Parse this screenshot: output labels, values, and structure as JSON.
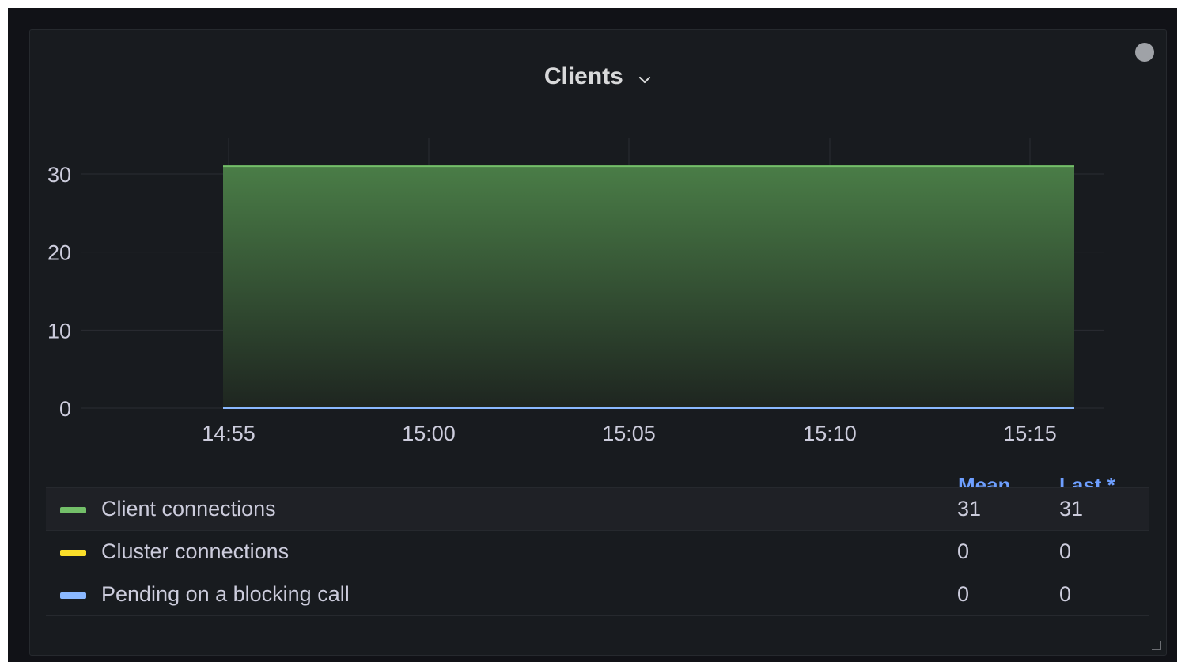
{
  "panel": {
    "title": "Clients",
    "menu_icon": "chevron-down-icon",
    "status_icon": "status-dot-icon"
  },
  "legend": {
    "headers": {
      "mean": "Mean",
      "last": "Last *"
    },
    "rows": [
      {
        "name": "Client connections",
        "color": "#73bf69",
        "mean": "31",
        "last": "31"
      },
      {
        "name": "Cluster connections",
        "color": "#fade2a",
        "mean": "0",
        "last": "0"
      },
      {
        "name": "Pending on a blocking call",
        "color": "#8ab8ff",
        "mean": "0",
        "last": "0"
      }
    ]
  },
  "chart_data": {
    "type": "area",
    "x": [
      "14:55",
      "15:00",
      "15:05",
      "15:10",
      "15:15"
    ],
    "ylim": [
      0,
      31
    ],
    "yticks": [
      "0",
      "10",
      "20",
      "30"
    ],
    "grid": true,
    "legend_position": "bottom",
    "series": [
      {
        "name": "Client connections",
        "color": "#73bf69",
        "values": [
          31,
          31,
          31,
          31,
          31
        ],
        "fill": true
      },
      {
        "name": "Cluster connections",
        "color": "#fade2a",
        "values": [
          0,
          0,
          0,
          0,
          0
        ],
        "fill": false
      },
      {
        "name": "Pending on a blocking call",
        "color": "#8ab8ff",
        "values": [
          0,
          0,
          0,
          0,
          0
        ],
        "fill": false
      }
    ]
  }
}
